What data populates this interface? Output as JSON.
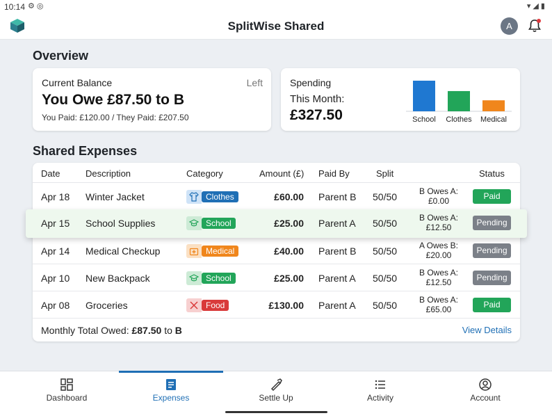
{
  "status_bar": {
    "time": "10:14",
    "icons": [
      "settings-icon",
      "at-icon",
      "wifi-icon",
      "signal-icon",
      "battery-icon"
    ]
  },
  "app": {
    "title": "SplitWise Shared",
    "avatar_initial": "A"
  },
  "overview": {
    "heading": "Overview",
    "balance": {
      "label": "Current Balance",
      "tag": "Left",
      "headline": "You Owe £87.50 to B",
      "detail": "You Paid: £120.00 / They Paid: £207.50"
    },
    "spending": {
      "label": "Spending",
      "period": "This Month:",
      "amount": "£327.50",
      "chart_data": {
        "type": "bar",
        "categories": [
          "School",
          "Clothes",
          "Medical"
        ],
        "values": [
          132.5,
          87.5,
          47.5
        ],
        "colors": [
          "#1f78d1",
          "#22a559",
          "#f0861c"
        ]
      }
    }
  },
  "expenses": {
    "heading": "Shared Expenses",
    "columns": {
      "date": "Date",
      "description": "Description",
      "category": "Category",
      "amount": "Amount (£)",
      "paid_by": "Paid By",
      "split": "Split",
      "status": "Status"
    },
    "rows": [
      {
        "date": "Apr 18",
        "description": "Winter Jacket",
        "category": "Clothes",
        "category_icon": "shirt-icon",
        "category_color": "#1f6fb5",
        "icon_bg": "#cfe3f7",
        "amount": "£60.00",
        "paid_by": "Parent B",
        "split": "50/50",
        "owe_line1": "B Owes A:",
        "owe_line2": "£0.00",
        "status": "Paid",
        "status_color": "#22a559"
      },
      {
        "date": "Apr 15",
        "description": "School Supplies",
        "category": "School",
        "category_icon": "graduation-cap-icon",
        "category_color": "#22a559",
        "icon_bg": "#cdebd6",
        "amount": "£25.00",
        "paid_by": "Parent A",
        "split": "50/50",
        "owe_line1": "B Owes A:",
        "owe_line2": "£12.50",
        "status": "Pending",
        "status_color": "#7b8088"
      },
      {
        "date": "Apr 14",
        "description": "Medical Checkup",
        "category": "Medical",
        "category_icon": "medical-kit-icon",
        "category_color": "#f0861c",
        "icon_bg": "#fbe0c3",
        "amount": "£40.00",
        "paid_by": "Parent B",
        "split": "50/50",
        "owe_line1": "A Owes B:",
        "owe_line2": "£20.00",
        "status": "Pending",
        "status_color": "#7b8088"
      },
      {
        "date": "Apr 10",
        "description": "New Backpack",
        "category": "School",
        "category_icon": "graduation-cap-icon",
        "category_color": "#22a559",
        "icon_bg": "#cdebd6",
        "amount": "£25.00",
        "paid_by": "Parent A",
        "split": "50/50",
        "owe_line1": "B Owes A:",
        "owe_line2": "£12.50",
        "status": "Pending",
        "status_color": "#7b8088"
      },
      {
        "date": "Apr 08",
        "description": "Groceries",
        "category": "Food",
        "category_icon": "utensils-icon",
        "category_color": "#d93a3a",
        "icon_bg": "#f7d0d0",
        "amount": "£130.00",
        "paid_by": "Parent A",
        "split": "50/50",
        "owe_line1": "B Owes A:",
        "owe_line2": "£65.00",
        "status": "Paid",
        "status_color": "#22a559"
      }
    ],
    "footer": {
      "total_label": "Monthly Total Owed:",
      "total_amount": "£87.50",
      "total_to": "to",
      "total_party": "B",
      "link": "View Details"
    }
  },
  "nav": {
    "items": [
      {
        "label": "Dashboard",
        "icon": "dashboard-icon"
      },
      {
        "label": "Expenses",
        "icon": "receipt-icon",
        "active": true
      },
      {
        "label": "Settle Up",
        "icon": "handshake-icon"
      },
      {
        "label": "Activity",
        "icon": "list-icon"
      },
      {
        "label": "Account",
        "icon": "account-icon"
      }
    ]
  }
}
